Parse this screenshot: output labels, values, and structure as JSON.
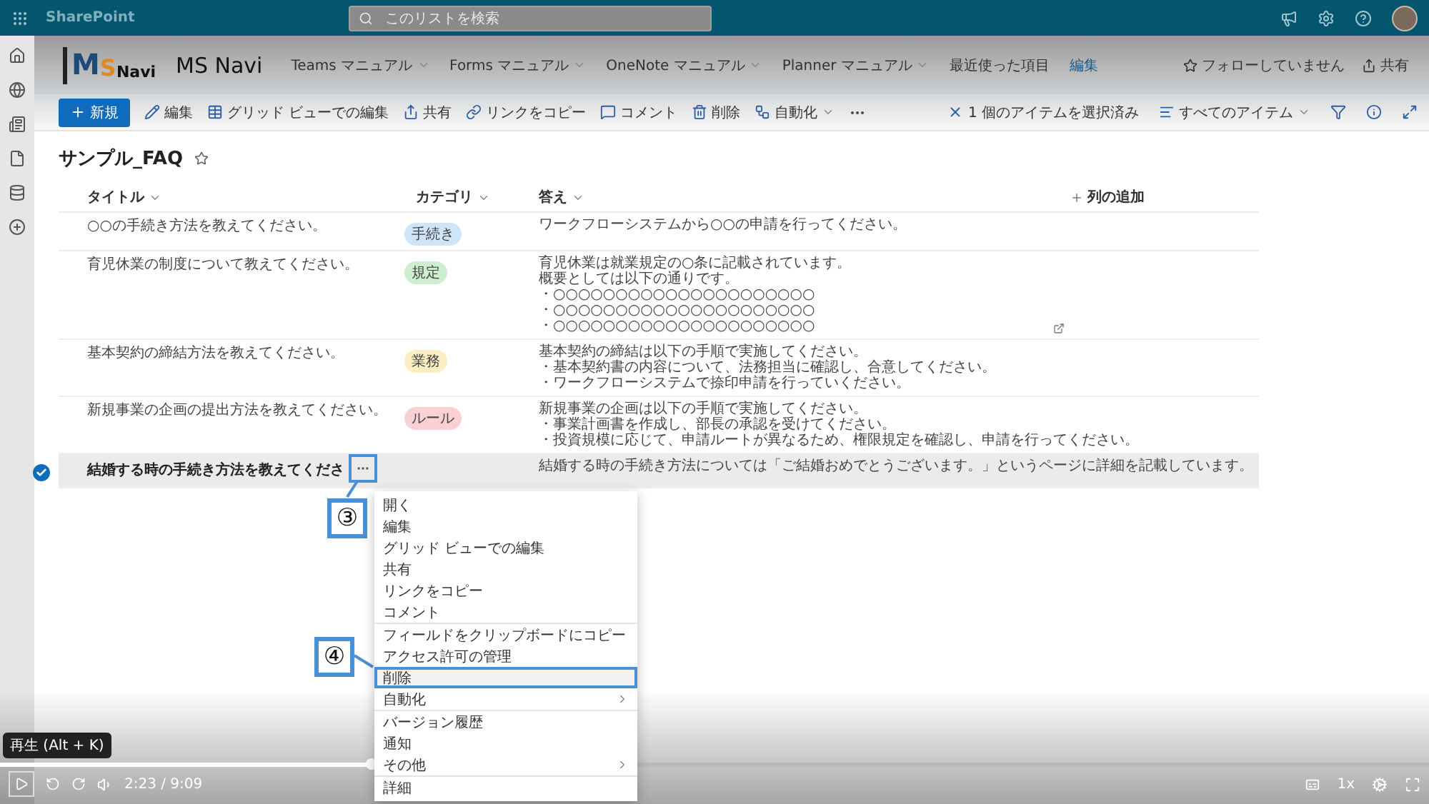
{
  "app_bar": {
    "product": "SharePoint",
    "search": {
      "placeholder": "このリストを検索"
    }
  },
  "site": {
    "logo": [
      "M",
      "S",
      "Navi"
    ],
    "name": "MS Navi",
    "nav": [
      {
        "label": "Teams マニュアル",
        "kind": "menu"
      },
      {
        "label": "Forms マニュアル",
        "kind": "menu"
      },
      {
        "label": "OneNote マニュアル",
        "kind": "menu"
      },
      {
        "label": "Planner マニュアル",
        "kind": "menu"
      },
      {
        "label": "最近使った項目",
        "kind": "item"
      },
      {
        "label": "編集",
        "kind": "link"
      }
    ],
    "follow": "フォローしていません",
    "share": "共有"
  },
  "commands": [
    {
      "label": "新規",
      "kind": "primary"
    },
    {
      "label": "編集",
      "kind": "plain"
    },
    {
      "label": "グリッド ビューでの編集",
      "kind": "plain"
    },
    {
      "label": "共有",
      "kind": "plain"
    },
    {
      "label": "リンクをコピー",
      "kind": "plain"
    },
    {
      "label": "コメント",
      "kind": "plain"
    },
    {
      "label": "削除",
      "kind": "plain"
    },
    {
      "label": "自動化",
      "kind": "menu"
    }
  ],
  "selection": "1 個のアイテムを選択済み",
  "view": "すべてのアイテム",
  "list": {
    "title": "サンプル_FAQ",
    "columns": [
      "タイトル",
      "カテゴリ",
      "答え"
    ],
    "add_column": "列の追加",
    "rows": [
      {
        "selected": false,
        "title": "○○の手続き方法を教えてください。",
        "category": {
          "label": "手続き",
          "color": "#cfe4f7"
        },
        "answer": [
          "ワークフローシステムから○○の申請を行ってください。"
        ]
      },
      {
        "selected": false,
        "title": "育児休業の制度について教えてください。",
        "category": {
          "label": "規定",
          "color": "#cdeecf"
        },
        "answer": [
          "育児休業は就業規定の○条に記載されています。",
          "概要としては以下の通りです。",
          "・○○○○○○○○○○○○○○○○○○○○○",
          "・○○○○○○○○○○○○○○○○○○○○○",
          "・○○○○○○○○○○○○○○○○○○○○○"
        ]
      },
      {
        "selected": false,
        "title": "基本契約の締結方法を教えてください。",
        "category": {
          "label": "業務",
          "color": "#fbeec2"
        },
        "answer": [
          "基本契約の締結は以下の手順で実施してください。",
          "・基本契約書の内容について、法務担当に確認し、合意してください。",
          "・ワークフローシステムで捺印申請を行っていください。"
        ]
      },
      {
        "selected": false,
        "title": "新規事業の企画の提出方法を教えてください。",
        "category": {
          "label": "ルール",
          "color": "#f9d0d3"
        },
        "answer": [
          "新規事業の企画は以下の手順で実施してください。",
          "・事業計画書を作成し、部長の承認を受けてください。",
          "・投資規模に応じて、申請ルートが異なるため、権限規定を確認し、申請を行ってください。"
        ]
      },
      {
        "selected": true,
        "title": "結婚する時の手続き方法を教えてくださ",
        "answer": [
          "結婚する時の手続き方法については「ご結婚おめでとうございます。」というページに詳細を記載しています。"
        ],
        "more_highlighted": true
      }
    ]
  },
  "context_menu": [
    {
      "label": "開く",
      "kind": "item",
      "separator_above": false,
      "highlighted": false
    },
    {
      "label": "編集",
      "kind": "item",
      "separator_above": false,
      "highlighted": false
    },
    {
      "label": "グリッド ビューでの編集",
      "kind": "item",
      "separator_above": false,
      "highlighted": false
    },
    {
      "label": "共有",
      "kind": "item",
      "separator_above": false,
      "highlighted": false
    },
    {
      "label": "リンクをコピー",
      "kind": "item",
      "separator_above": false,
      "highlighted": false
    },
    {
      "label": "コメント",
      "kind": "item",
      "separator_above": false,
      "highlighted": false
    },
    {
      "label": "フィールドをクリップボードにコピー",
      "kind": "item",
      "separator_above": true,
      "highlighted": false
    },
    {
      "label": "アクセス許可の管理",
      "kind": "item",
      "separator_above": false,
      "highlighted": false
    },
    {
      "label": "削除",
      "kind": "item",
      "separator_above": false,
      "highlighted": true
    },
    {
      "label": "自動化",
      "kind": "submenu",
      "separator_above": false,
      "highlighted": false
    },
    {
      "label": "バージョン履歴",
      "kind": "item",
      "separator_above": true,
      "highlighted": false
    },
    {
      "label": "通知",
      "kind": "item",
      "separator_above": false,
      "highlighted": false
    },
    {
      "label": "その他",
      "kind": "submenu",
      "separator_above": false,
      "highlighted": false
    },
    {
      "label": "詳細",
      "kind": "item",
      "separator_above": true,
      "highlighted": false
    }
  ],
  "callouts": [
    {
      "label": "③"
    },
    {
      "label": "④"
    }
  ],
  "player": {
    "tooltip": "再生 (Alt + K)",
    "time": "2:23 / 9:09",
    "speed": "1x",
    "progress": {
      "level": 0.26
    }
  }
}
